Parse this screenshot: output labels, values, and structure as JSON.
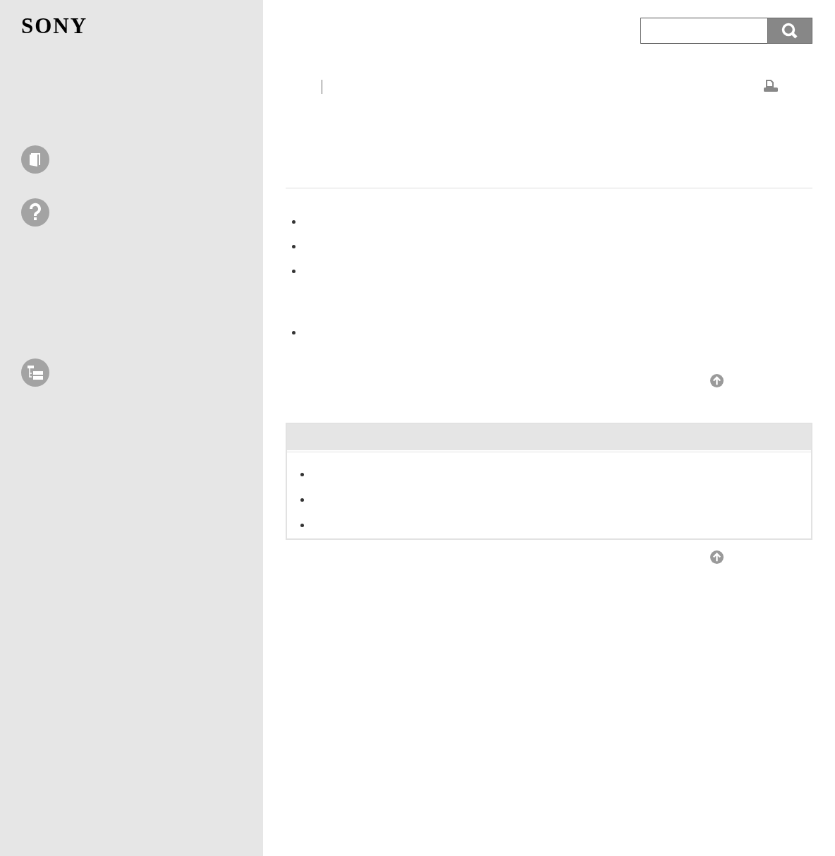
{
  "logo": {
    "text": "SONY"
  },
  "sidebar": {
    "items": [
      {
        "kind": "book"
      },
      {
        "kind": "help"
      },
      {
        "kind": "tree"
      }
    ]
  },
  "main": {
    "blocks": [
      {
        "kind": "bullet"
      },
      {
        "kind": "bullet"
      },
      {
        "kind": "bullet"
      },
      {
        "kind": "spacer"
      },
      {
        "kind": "bullet"
      }
    ],
    "box": {
      "items": [
        {
          "kind": "bullet"
        },
        {
          "kind": "bullet"
        },
        {
          "kind": "bullet"
        }
      ]
    }
  }
}
